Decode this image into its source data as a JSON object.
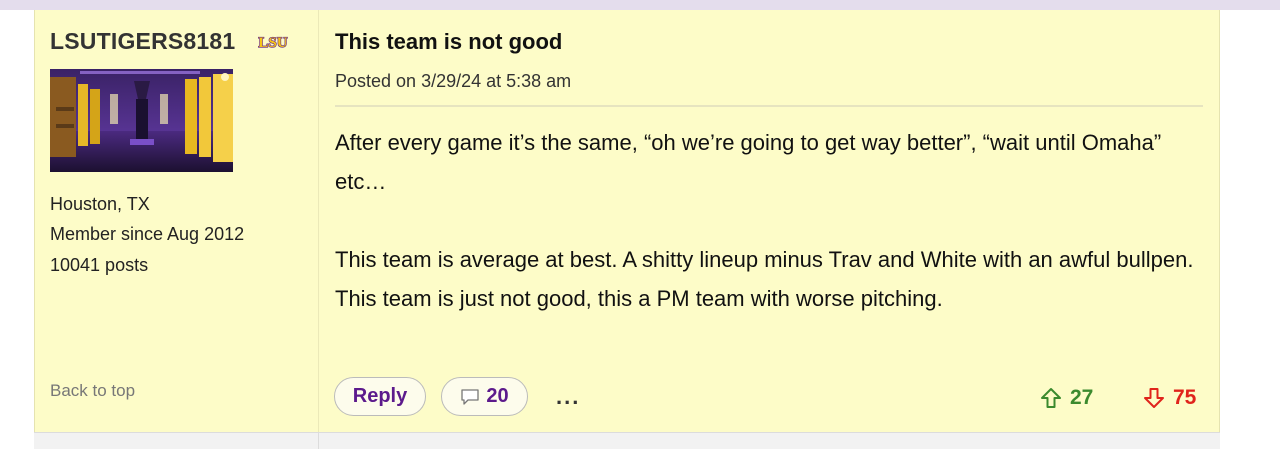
{
  "author": {
    "username": "LSUTIGERS8181",
    "team_logo_text": "LSU",
    "location": "Houston, TX",
    "member_since": "Member since Aug 2012",
    "post_count": "10041 posts",
    "back_to_top": "Back to top"
  },
  "post": {
    "title": "This team is not good",
    "posted": "Posted on 3/29/24 at 5:38 am",
    "paragraphs": [
      "After every game it’s the same, “oh we’re going to get way better”, “wait until Omaha” etc…",
      "This team is average at best. A shitty lineup minus Trav and White with an awful bullpen. This team is just not good, this a PM team with worse pitching."
    ]
  },
  "actions": {
    "reply_label": "Reply",
    "comment_count": "20",
    "more_label": "...",
    "upvotes": "27",
    "downvotes": "75"
  },
  "colors": {
    "post_bg": "#fdfcc8",
    "lsu_purple": "#5c1a8c",
    "lsu_gold": "#f5c518",
    "upvote_green": "#3b8a2e",
    "downvote_red": "#e0241c"
  }
}
